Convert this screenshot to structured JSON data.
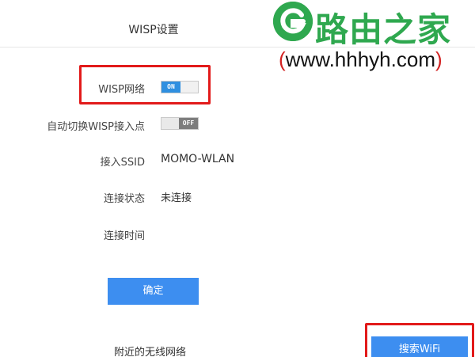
{
  "page": {
    "title": "WISP设置"
  },
  "settings": {
    "wisp_network": {
      "label": "WISP网络",
      "state": "ON"
    },
    "auto_switch": {
      "label": "自动切换WISP接入点",
      "state": "OFF"
    },
    "ssid": {
      "label": "接入SSID",
      "value": "MOMO-WLAN"
    },
    "conn_status": {
      "label": "连接状态",
      "value": "未连接"
    },
    "conn_time": {
      "label": "连接时间",
      "value": ""
    }
  },
  "actions": {
    "confirm_label": "确定",
    "search_label": "搜索WiFi"
  },
  "nearby": {
    "label": "附近的无线网络"
  },
  "watermark": {
    "site_name": "路由之家",
    "url_open": "(",
    "url_text": "www.hhhyh.com",
    "url_close": ")"
  },
  "colors": {
    "accent": "#3d8ef0",
    "toggle_on": "#2f8fe0",
    "annotation": "#e21a1a",
    "brand_green": "#2fa84f"
  }
}
